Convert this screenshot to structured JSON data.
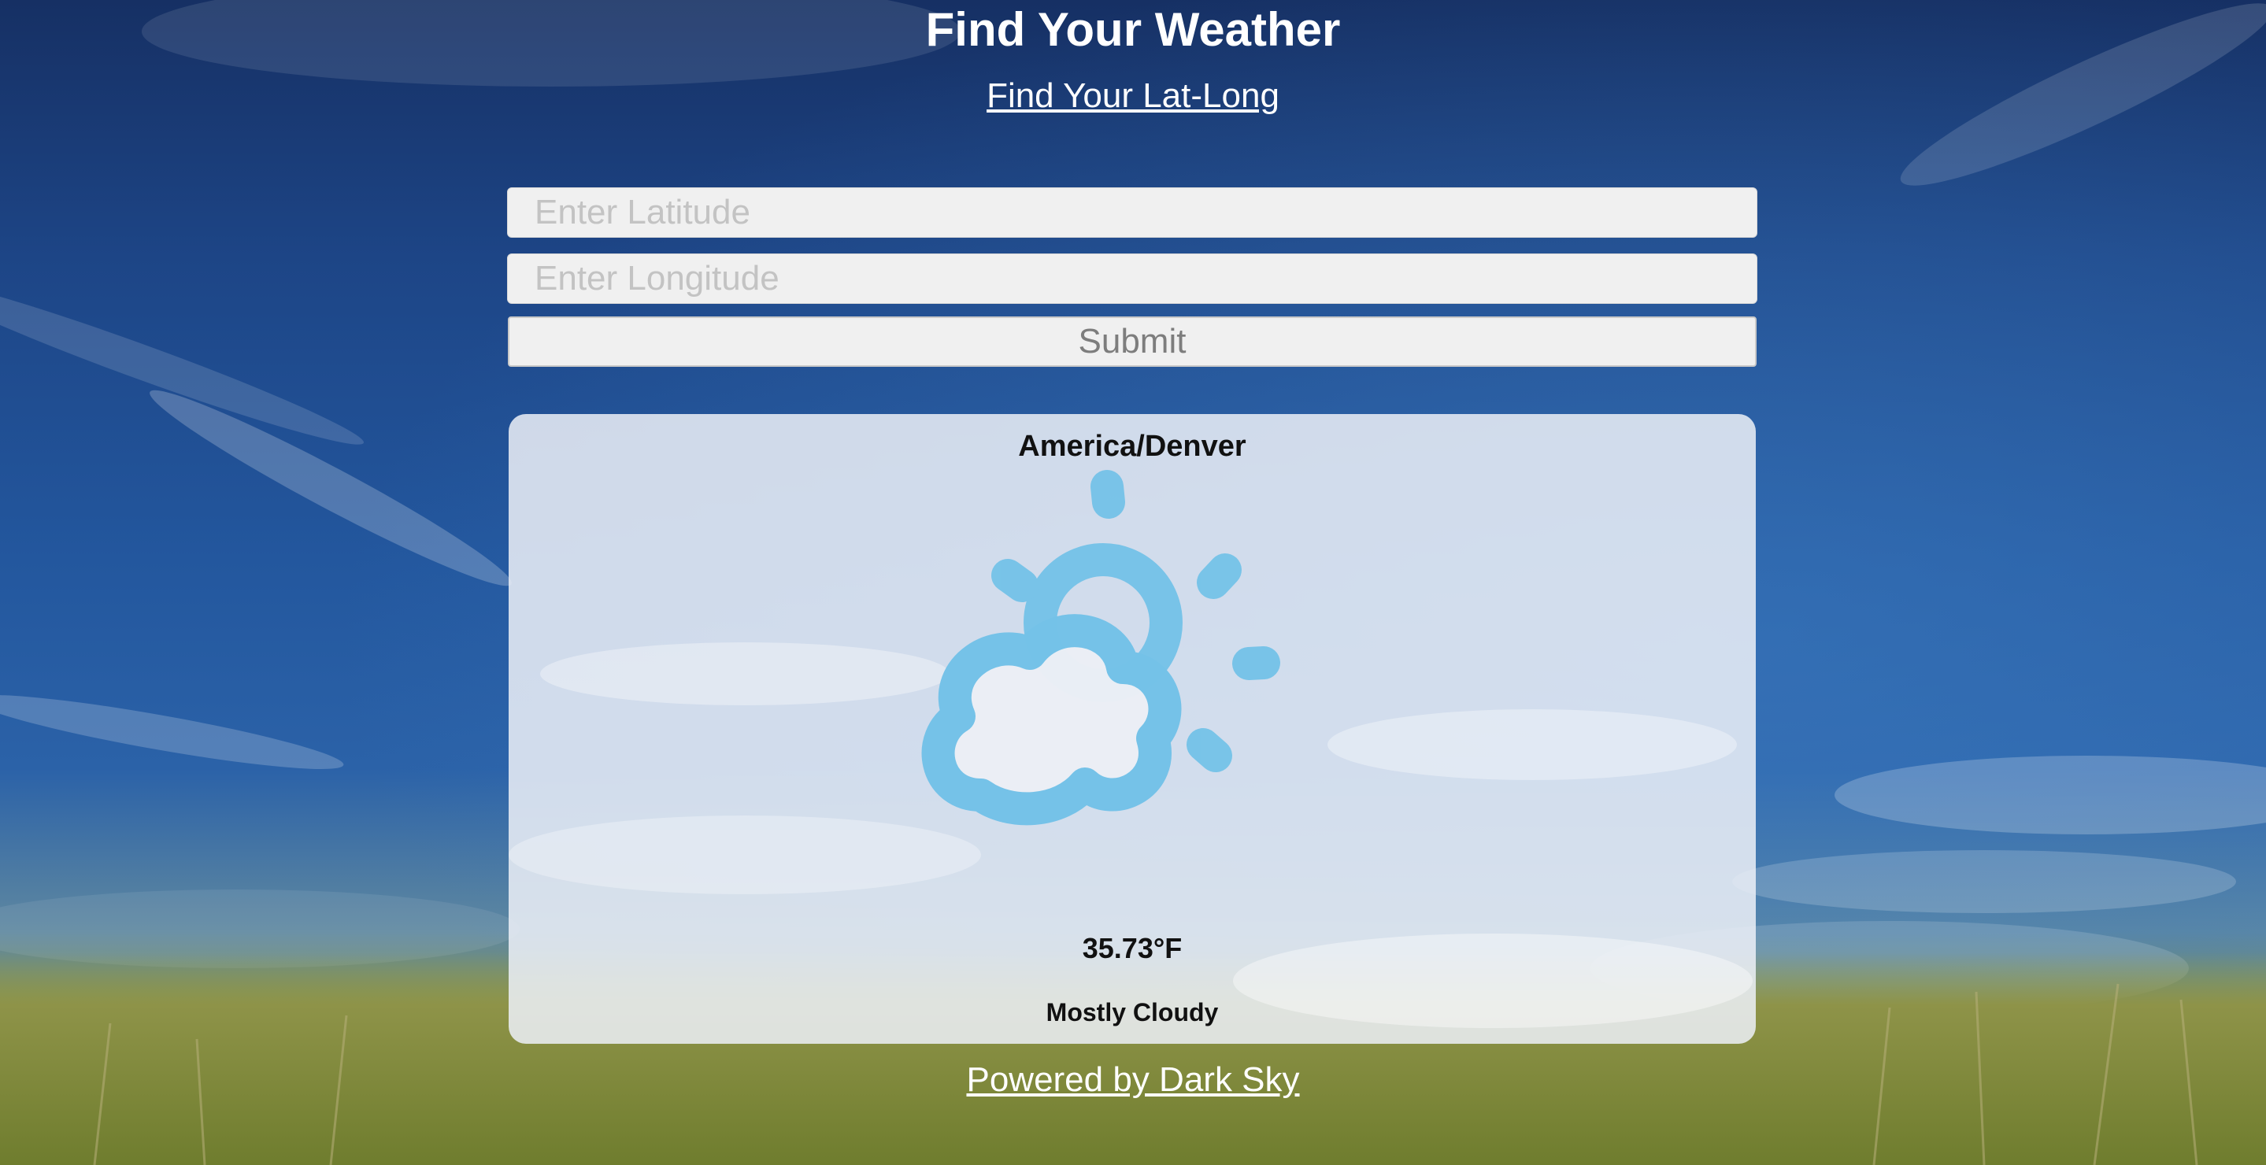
{
  "header": {
    "title": "Find Your Weather",
    "latlong_link": "Find Your Lat-Long"
  },
  "form": {
    "latitude_placeholder": "Enter Latitude",
    "longitude_placeholder": "Enter Longitude",
    "latitude_value": "",
    "longitude_value": "",
    "submit_label": "Submit"
  },
  "result": {
    "timezone": "America/Denver",
    "icon": "partly-cloudy-day-icon",
    "temperature": "35.73°F",
    "summary": "Mostly Cloudy"
  },
  "footer": {
    "powered_by": "Powered by Dark Sky"
  },
  "colors": {
    "icon": "#74c2e8",
    "card_background": "#ecf0f7",
    "sky": "#1d4586",
    "grass": "#7a8a36"
  }
}
